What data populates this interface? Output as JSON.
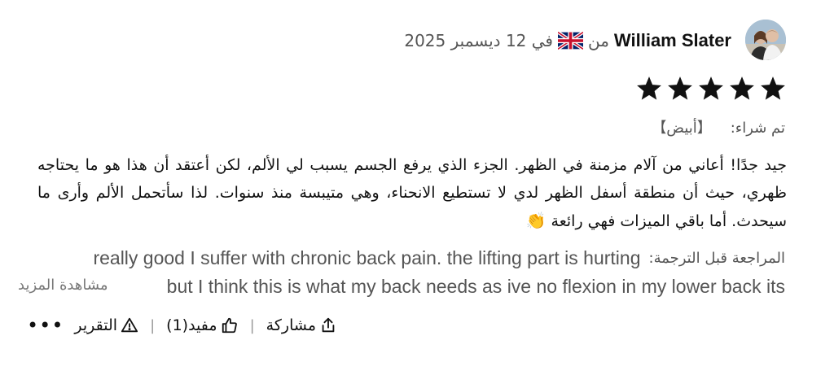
{
  "reviewer": {
    "name": "William Slater",
    "from_label": "من",
    "date_text": "في 12 ديسمبر 2025",
    "flag_icon": "uk-flag-icon"
  },
  "rating": {
    "stars": 5,
    "max": 5
  },
  "purchase": {
    "label": "تم شراء:",
    "value": "【أبيض】"
  },
  "body": {
    "text": "جيد جدًا! أعاني من آلام مزمنة في الظهر. الجزء الذي يرفع الجسم يسبب لي الألم، لكن أعتقد أن هذا هو ما يحتاجه ظهري، حيث أن منطقة أسفل الظهر لدي لا تستطيع الانحناء، وهي متيبسة منذ سنوات. لذا سأتحمل الألم وأرى ما سيحدث. أما باقي الميزات فهي رائعة",
    "emoji": "👏"
  },
  "translation": {
    "label": "المراجعة قبل الترجمة:",
    "line1": "really good I suffer with chronic back pain. the lifting part is hurting",
    "line2": "but I think this is what my back needs as ive no flexion in my lower back its",
    "see_more": "مشاهدة المزيد"
  },
  "actions": {
    "share": "مشاركة",
    "helpful": "مفيد(1)",
    "report": "التقرير",
    "more": "•••"
  }
}
